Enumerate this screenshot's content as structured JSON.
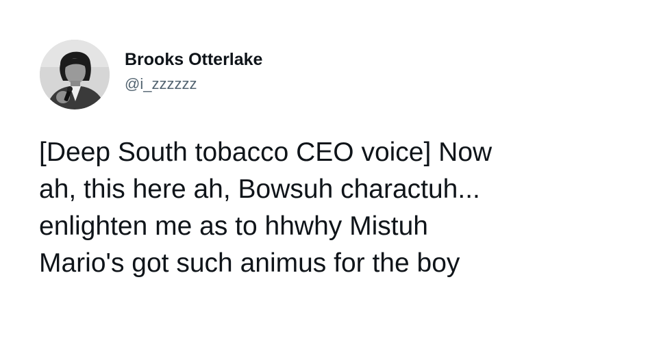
{
  "tweet": {
    "author": {
      "display_name": "Brooks Otterlake",
      "handle": "@i_zzzzzz",
      "avatar_icon": "profile-photo"
    },
    "text_lines": [
      "[Deep South tobacco CEO voice] Now",
      "ah, this here ah, Bowsuh charactuh...",
      "enlighten me as to hhwhy Mistuh",
      "Mario's got such animus for the boy"
    ]
  },
  "colors": {
    "text": "#0f1419",
    "handle": "#536471",
    "background": "#ffffff"
  }
}
